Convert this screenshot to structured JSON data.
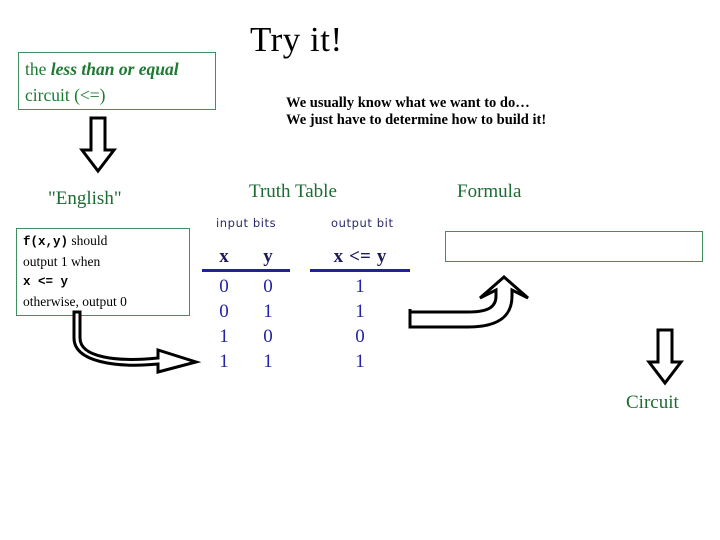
{
  "slide": {
    "title": "Try it!",
    "subtitle_line1": "We usually know what we want to do…",
    "subtitle_line2": "We just have to determine how to build it!"
  },
  "topic_box": {
    "prefix": "the ",
    "emphasis": "less than or equal",
    "suffix": " circuit (<=)"
  },
  "headings": {
    "english": "\"English\"",
    "truth_table": "Truth Table",
    "formula": "Formula",
    "circuit": "Circuit"
  },
  "english_box": {
    "line1_code": "f(x,y)",
    "line1_text": " should",
    "line2": "output 1 when",
    "line3_code": "x <= y",
    "line4": "otherwise, output 0"
  },
  "truth_table": {
    "input_label": "input bits",
    "output_label": "output bit",
    "input_headers": [
      "x",
      "y"
    ],
    "output_header_parts": [
      "x",
      "<=",
      "y"
    ],
    "output_header": "x <= y",
    "input_rows": [
      [
        "0",
        "0"
      ],
      [
        "0",
        "1"
      ],
      [
        "1",
        "0"
      ],
      [
        "1",
        "1"
      ]
    ],
    "output_rows": [
      "1",
      "1",
      "0",
      "1"
    ]
  },
  "formula_box": {
    "value": "",
    "placeholder": ""
  },
  "colors": {
    "green_text": "#1d6b33",
    "green_border": "#3f8f5f",
    "navy_text": "#2222a8",
    "navy_rule": "#2020a0",
    "black": "#000000",
    "background": "#ffffff"
  },
  "icons": {
    "arrow_down_topic": "arrow-down-block",
    "arrow_english_to_table": "arrow-curved-right",
    "arrow_table_to_formula": "arrow-uturn-up",
    "arrow_formula_to_circuit": "arrow-down-block"
  }
}
